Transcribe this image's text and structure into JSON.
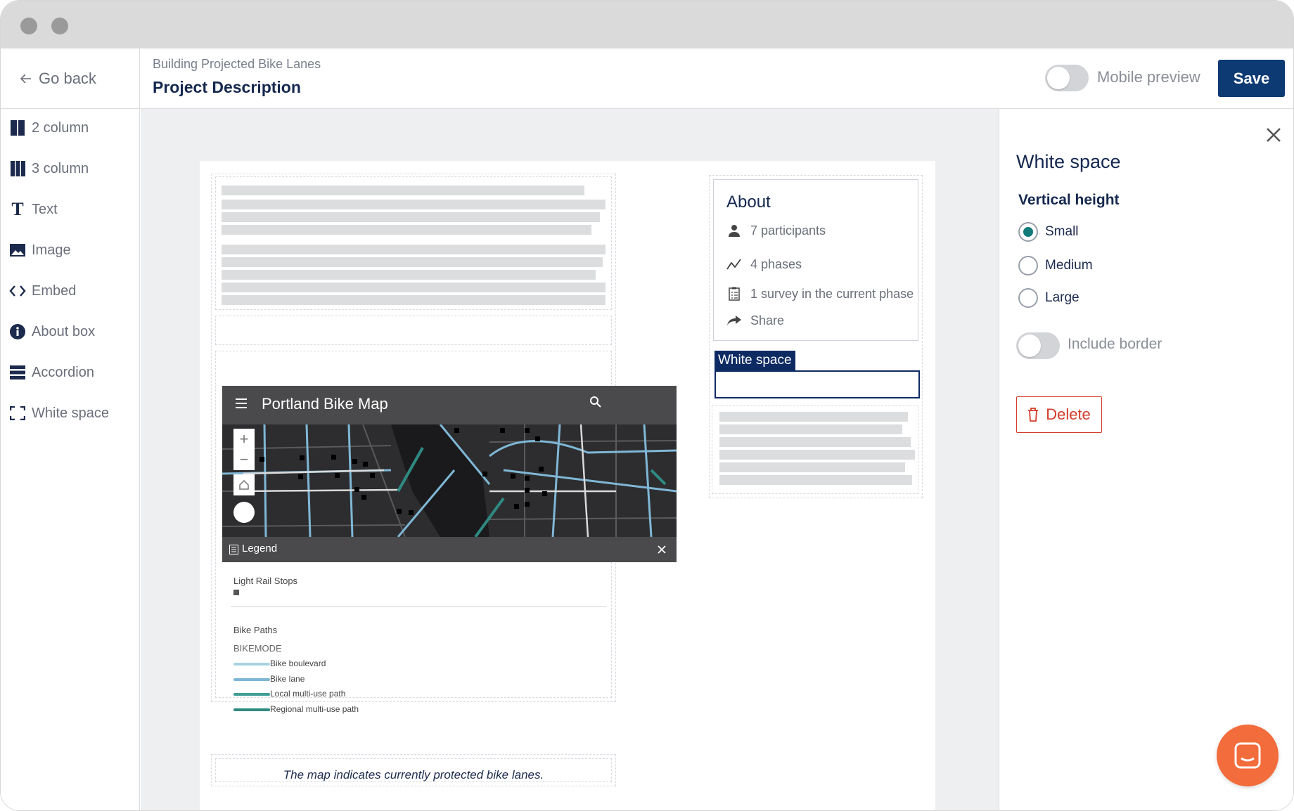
{
  "topbar": {
    "go_back": "Go back",
    "breadcrumb": "Building Projected Bike Lanes",
    "page_title": "Project Description",
    "mobile_preview": "Mobile preview",
    "save": "Save"
  },
  "sidebar": {
    "items": [
      {
        "label": "2 column",
        "icon": "two-column-icon"
      },
      {
        "label": "3 column",
        "icon": "three-column-icon"
      },
      {
        "label": "Text",
        "icon": "text-icon"
      },
      {
        "label": "Image",
        "icon": "image-icon"
      },
      {
        "label": "Embed",
        "icon": "embed-icon"
      },
      {
        "label": "About box",
        "icon": "info-icon"
      },
      {
        "label": "Accordion",
        "icon": "accordion-icon"
      },
      {
        "label": "White space",
        "icon": "white-space-icon"
      }
    ]
  },
  "about": {
    "title": "About",
    "participants": "7 participants",
    "phases": "4 phases",
    "survey": "1 survey in the current phase",
    "share": "Share"
  },
  "white_space_tag": "White space",
  "map": {
    "title": "Portland Bike Map",
    "legend": "Legend",
    "light_rail_title": "Light Rail Stops",
    "bike_paths_title": "Bike Paths",
    "bikemode": "BIKEMODE",
    "legend_items": [
      "Bike boulevard",
      "Bike lane",
      "Local multi-use path",
      "Regional multi-use path"
    ],
    "legend_colors": [
      "#a7d3df",
      "#7fb7d6",
      "#3f9e96",
      "#2f8a82"
    ]
  },
  "caption": "The map indicates currently protected bike lanes.",
  "panel": {
    "title": "White space",
    "vertical_height": "Vertical height",
    "options": [
      "Small",
      "Medium",
      "Large"
    ],
    "selected": "Small",
    "include_border": "Include border",
    "delete": "Delete"
  },
  "colors": {
    "navy": "#0e3a74",
    "accent_teal": "#147b7b",
    "danger": "#d23c2a",
    "chat": "#f36c3b"
  }
}
